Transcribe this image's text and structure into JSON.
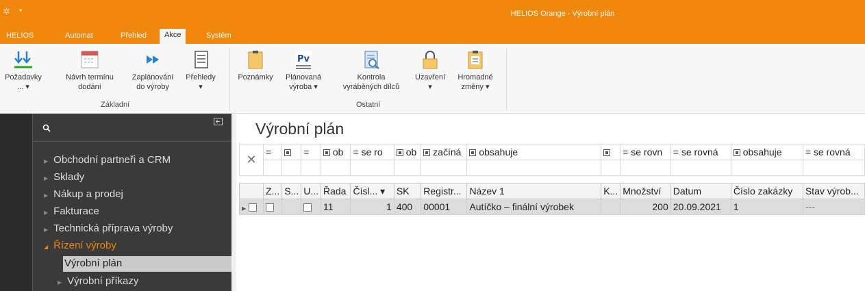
{
  "window": {
    "title": "HELIOS Orange - Výrobní plán"
  },
  "tabs": [
    "HELIOS",
    "Automat",
    "Přehled",
    "Akce",
    "Systém"
  ],
  "ribbon": {
    "zakladni": {
      "group_label": "Základní",
      "requests_l1": "Požadavky",
      "requests_l2": "... ▾",
      "deadline_l1": "Návrh termínu",
      "deadline_l2": "dodání",
      "planning_l1": "Zaplánování",
      "planning_l2": "do výroby",
      "overviews_l1": "Přehledy",
      "overviews_l2": "▾"
    },
    "ostatni": {
      "group_label": "Ostatní",
      "notes": "Poznámky",
      "planned_l1": "Plánovaná",
      "planned_l2": "výroba ▾",
      "control_l1": "Kontrola",
      "control_l2": "vyráběných dílců",
      "closing_l1": "Uzavření",
      "closing_l2": "▾",
      "bulk_l1": "Hromadné",
      "bulk_l2": "změny ▾",
      "pv_icon_text": "Pv"
    }
  },
  "nav": {
    "items": [
      "Obchodní partneři a CRM",
      "Sklady",
      "Nákup a prodej",
      "Fakturace",
      "Technická příprava výroby",
      "Řízení výroby"
    ],
    "subitems": [
      "Výrobní plán",
      "Výrobní příkazy"
    ]
  },
  "page": {
    "title": "Výrobní plán"
  },
  "grid": {
    "filters": [
      "=",
      "=",
      "=",
      "ob",
      "= se ro",
      "ob",
      "začíná",
      "obsahuje",
      "",
      "= se rovn",
      "= se rovná",
      "obsahuje",
      "= se rovná"
    ],
    "columns": [
      "Z...",
      "S...",
      "U...",
      "Řada",
      "Čísl... ▾",
      "SK",
      "Registr...",
      "Název 1",
      "K...",
      "Množství",
      "Datum",
      "Číslo zakázky",
      "Stav výrob..."
    ],
    "rows": [
      {
        "rada": "11",
        "cislo": "1",
        "sk": "400",
        "registr": "00001",
        "nazev": "Autíčko – finální výrobek",
        "k": "",
        "mnozstvi": "200",
        "datum": "20.09.2021",
        "zakazka": "1",
        "stav": "---"
      }
    ]
  }
}
